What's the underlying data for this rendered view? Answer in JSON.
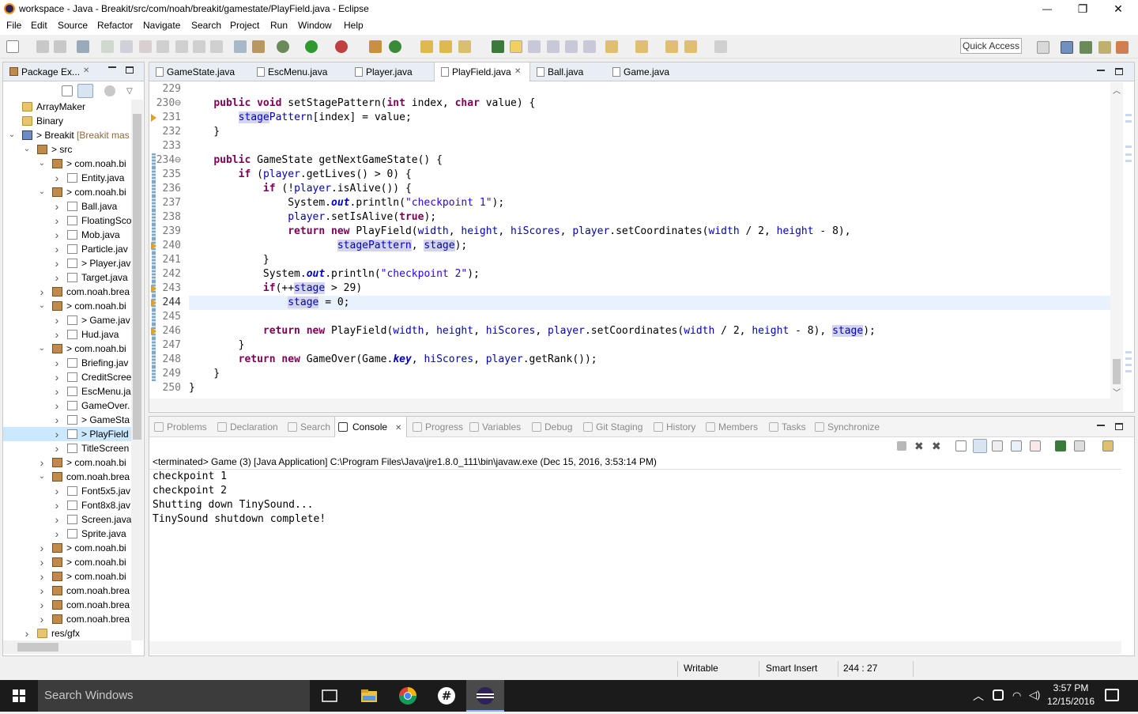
{
  "window": {
    "title": "workspace - Java - Breakit/src/com/noah/breakit/gamestate/PlayField.java - Eclipse",
    "minimize": "—",
    "maximize": "❐",
    "close": "✕"
  },
  "menu": [
    "File",
    "Edit",
    "Source",
    "Refactor",
    "Navigate",
    "Search",
    "Project",
    "Run",
    "Window",
    "Help"
  ],
  "quick_access": "Quick Access",
  "package_explorer": {
    "tab_label": "Package Ex...",
    "tree": [
      {
        "label": "ArrayMaker",
        "type": "folder",
        "indent": 0,
        "arrow": ""
      },
      {
        "label": "Binary",
        "type": "folder",
        "indent": 0,
        "arrow": ""
      },
      {
        "label": "> Breakit",
        "extra": " [Breakit mas",
        "type": "proj",
        "indent": 0,
        "arrow": "v"
      },
      {
        "label": "> src",
        "type": "pkg",
        "indent": 1,
        "arrow": "v"
      },
      {
        "label": "> com.noah.bi",
        "type": "pkg",
        "indent": 2,
        "arrow": "v"
      },
      {
        "label": "Entity.java",
        "type": "java",
        "indent": 3,
        "arrow": ">"
      },
      {
        "label": "> com.noah.bi",
        "type": "pkg",
        "indent": 2,
        "arrow": "v"
      },
      {
        "label": "Ball.java",
        "type": "java",
        "indent": 3,
        "arrow": ">"
      },
      {
        "label": "FloatingSco",
        "type": "java",
        "indent": 3,
        "arrow": ">"
      },
      {
        "label": "Mob.java",
        "type": "java",
        "indent": 3,
        "arrow": ">"
      },
      {
        "label": "Particle.jav",
        "type": "java",
        "indent": 3,
        "arrow": ">"
      },
      {
        "label": "> Player.jav",
        "type": "java",
        "indent": 3,
        "arrow": ">"
      },
      {
        "label": "Target.java",
        "type": "java",
        "indent": 3,
        "arrow": ">"
      },
      {
        "label": "com.noah.brea",
        "type": "pkg",
        "indent": 2,
        "arrow": ">"
      },
      {
        "label": "> com.noah.bi",
        "type": "pkg",
        "indent": 2,
        "arrow": "v"
      },
      {
        "label": "> Game.jav",
        "type": "java",
        "indent": 3,
        "arrow": ">"
      },
      {
        "label": "Hud.java",
        "type": "java",
        "indent": 3,
        "arrow": ">"
      },
      {
        "label": "> com.noah.bi",
        "type": "pkg",
        "indent": 2,
        "arrow": "v"
      },
      {
        "label": "Briefing.jav",
        "type": "java",
        "indent": 3,
        "arrow": ">"
      },
      {
        "label": "CreditScree",
        "type": "java",
        "indent": 3,
        "arrow": ">"
      },
      {
        "label": "EscMenu.ja",
        "type": "java",
        "indent": 3,
        "arrow": ">"
      },
      {
        "label": "GameOver.",
        "type": "java",
        "indent": 3,
        "arrow": ">"
      },
      {
        "label": "> GameSta",
        "type": "java",
        "indent": 3,
        "arrow": ">"
      },
      {
        "label": "> PlayField",
        "type": "java",
        "indent": 3,
        "arrow": ">",
        "selected": true
      },
      {
        "label": "TitleScreen",
        "type": "java",
        "indent": 3,
        "arrow": ">"
      },
      {
        "label": "> com.noah.bi",
        "type": "pkg",
        "indent": 2,
        "arrow": ">"
      },
      {
        "label": "com.noah.brea",
        "type": "pkg",
        "indent": 2,
        "arrow": "v"
      },
      {
        "label": "Font5x5.jav",
        "type": "java",
        "indent": 3,
        "arrow": ">"
      },
      {
        "label": "Font8x8.jav",
        "type": "java",
        "indent": 3,
        "arrow": ">"
      },
      {
        "label": "Screen.java",
        "type": "java",
        "indent": 3,
        "arrow": ">"
      },
      {
        "label": "Sprite.java",
        "type": "java",
        "indent": 3,
        "arrow": ">"
      },
      {
        "label": "> com.noah.bi",
        "type": "pkg",
        "indent": 2,
        "arrow": ">"
      },
      {
        "label": "> com.noah.bi",
        "type": "pkg",
        "indent": 2,
        "arrow": ">"
      },
      {
        "label": "> com.noah.bi",
        "type": "pkg",
        "indent": 2,
        "arrow": ">"
      },
      {
        "label": "com.noah.brea",
        "type": "pkg",
        "indent": 2,
        "arrow": ">"
      },
      {
        "label": "com.noah.brea",
        "type": "pkg",
        "indent": 2,
        "arrow": ">"
      },
      {
        "label": "com.noah.brea",
        "type": "pkg",
        "indent": 2,
        "arrow": ">"
      },
      {
        "label": "res/gfx",
        "type": "folder",
        "indent": 1,
        "arrow": ">"
      }
    ]
  },
  "editor": {
    "tabs": [
      {
        "label": "GameState.java",
        "active": false
      },
      {
        "label": "EscMenu.java",
        "active": false
      },
      {
        "label": "Player.java",
        "active": false
      },
      {
        "label": "PlayField.java",
        "active": true
      },
      {
        "label": "Ball.java",
        "active": false
      },
      {
        "label": "Game.java",
        "active": false
      }
    ],
    "close_glyph": "✕",
    "line_numbers": [
      "229",
      "230⊖",
      "231",
      "232",
      "233",
      "234⊖",
      "235",
      "236",
      "237",
      "238",
      "239",
      "240",
      "241",
      "242",
      "243",
      "244",
      "245",
      "246",
      "247",
      "248",
      "249",
      "250"
    ],
    "current_line_index": 15
  },
  "console": {
    "tabs": [
      "Problems",
      "Declaration",
      "Search",
      "Console",
      "Progress",
      "Variables",
      "Debug",
      "Git Staging",
      "History",
      "Members",
      "Tasks",
      "Synchronize"
    ],
    "active_tab": "Console",
    "terminated_label": "<terminated> Game (3) [Java Application] C:\\Program Files\\Java\\jre1.8.0_111\\bin\\javaw.exe (Dec 15, 2016, 3:53:14 PM)",
    "output": [
      "checkpoint 1",
      "checkpoint 2",
      "Shutting down TinySound...",
      "TinySound shutdown complete!"
    ]
  },
  "status": {
    "writable": "Writable",
    "insert_mode": "Smart Insert",
    "position": "244 : 27"
  },
  "taskbar": {
    "search": "Search Windows",
    "time": "3:57 PM",
    "date": "12/15/2016"
  }
}
